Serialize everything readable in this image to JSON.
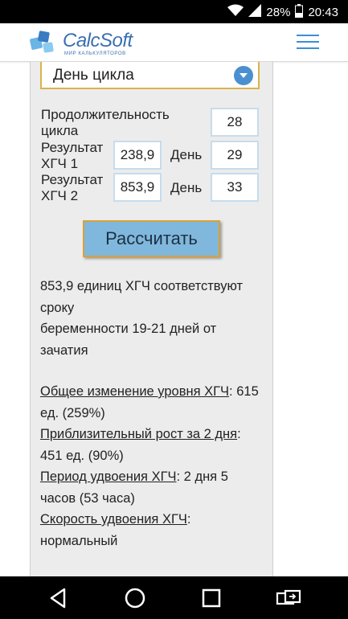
{
  "status_bar": {
    "battery_percent": "28%",
    "time": "20:43",
    "icons": [
      "wifi-icon",
      "cell-signal-icon",
      "battery-icon"
    ]
  },
  "app_bar": {
    "logo_text": "CalcSoft",
    "logo_subtitle": "МИР КАЛЬКУЛЯТОРОВ",
    "menu_icon": "hamburger-menu-icon",
    "accent_color": "#3b8fd6"
  },
  "form": {
    "select_value": "День цикла",
    "cycle_length": {
      "label_line1": "Продолжительность",
      "label_line2": "цикла",
      "value": "28"
    },
    "result1": {
      "label_line1": "Результат",
      "label_line2": "ХГЧ 1",
      "value": "238,9",
      "day_label": "День",
      "day_value": "29"
    },
    "result2": {
      "label_line1": "Результат",
      "label_line2": "ХГЧ 2",
      "value": "853,9",
      "day_label": "День",
      "day_value": "33"
    },
    "calculate_label": "Рассчитать"
  },
  "results": {
    "line1": "853,9 единиц ХГЧ соответствуют",
    "line2": "сроку",
    "line3": "беременности 19-21 дней от",
    "line4": "зачатия",
    "change_label": "Общее изменение уровня ХГЧ",
    "change_value_a": ": 615",
    "change_value_b": "ед. (259%)",
    "growth_label": "Приблизительный рост за 2 дня",
    "growth_value_a": ":",
    "growth_value_b": "451 ед. (90%)",
    "doubling_label": "Период удвоения ХГЧ",
    "doubling_value_a": ": 2 дня 5",
    "doubling_value_b": "часов (53 часа)",
    "speed_label": "Скорость удвоения ХГЧ",
    "speed_value_a": ":",
    "speed_value_b": "нормальный"
  },
  "nav_bar": {
    "icons": [
      "back-icon",
      "home-icon",
      "recents-icon",
      "screen-rotate-icon"
    ]
  }
}
